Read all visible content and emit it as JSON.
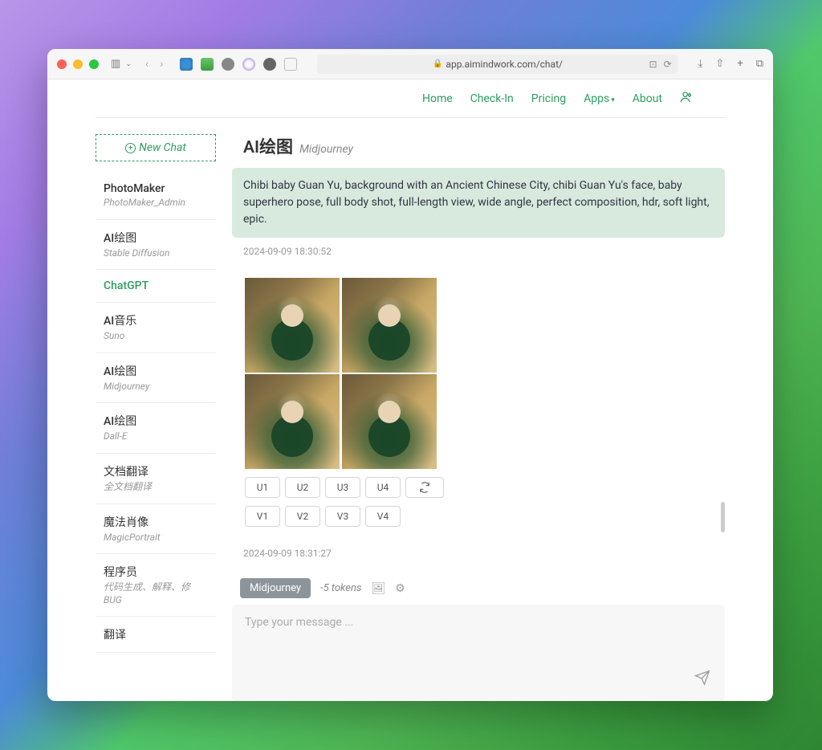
{
  "browser": {
    "url": "app.aimindwork.com/chat/"
  },
  "topnav": {
    "home": "Home",
    "checkin": "Check-In",
    "pricing": "Pricing",
    "apps": "Apps",
    "about": "About"
  },
  "sidebar": {
    "new_chat": "New Chat",
    "items": [
      {
        "title": "PhotoMaker",
        "sub": "PhotoMaker_Admin"
      },
      {
        "title": "AI绘图",
        "sub": "Stable Diffusion"
      },
      {
        "title": "ChatGPT",
        "sub": ""
      },
      {
        "title": "AI音乐",
        "sub": "Suno"
      },
      {
        "title": "AI绘图",
        "sub": "Midjourney"
      },
      {
        "title": "AI绘图",
        "sub": "Dall-E"
      },
      {
        "title": "文档翻译",
        "sub": "全文档翻译"
      },
      {
        "title": "魔法肖像",
        "sub": "MagicPortrait"
      },
      {
        "title": "程序员",
        "sub": "代码生成、解释、修BUG"
      },
      {
        "title": "翻译",
        "sub": ""
      }
    ],
    "active_index": 2
  },
  "chat": {
    "title": "AI绘图",
    "subtitle": "Midjourney",
    "prompt": "Chibi baby Guan Yu, background with an Ancient Chinese City, chibi Guan Yu's face, baby superhero pose, full body shot, full-length view, wide angle, perfect composition, hdr, soft light, epic.",
    "ts1": "2024-09-09 18:30:52",
    "ts2": "2024-09-09 18:31:27",
    "buttons_u": [
      "U1",
      "U2",
      "U3",
      "U4"
    ],
    "buttons_v": [
      "V1",
      "V2",
      "V3",
      "V4"
    ]
  },
  "input": {
    "model": "Midjourney",
    "tokens": "-5 tokens",
    "placeholder": "Type your message ..."
  }
}
